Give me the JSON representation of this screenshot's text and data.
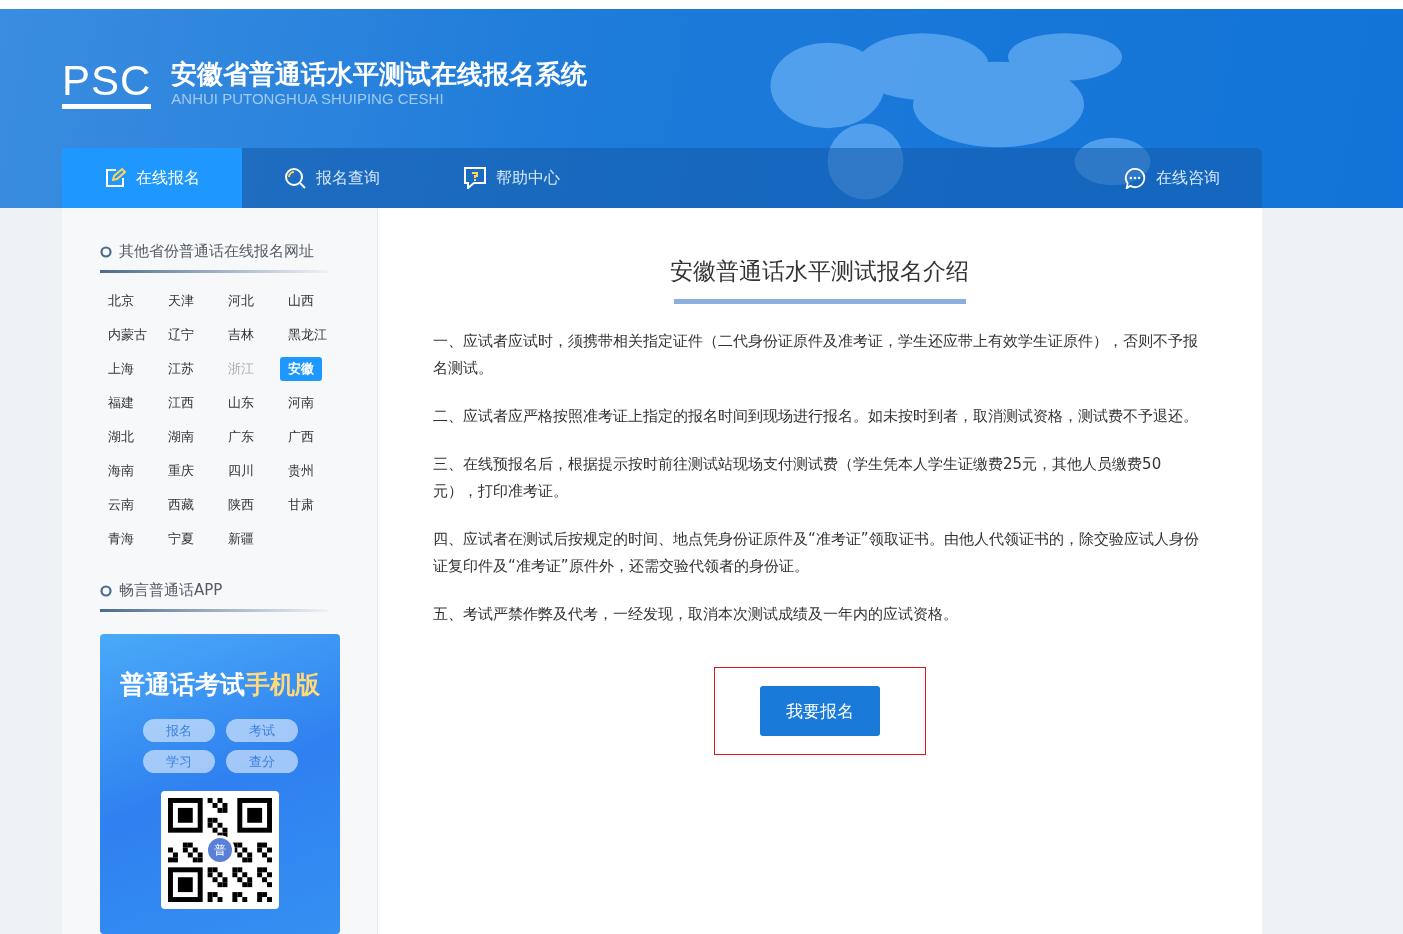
{
  "header": {
    "logo": "PSC",
    "title": "安徽省普通话水平测试在线报名系统",
    "subtitle": "ANHUI PUTONGHUA SHUIPING CESHI"
  },
  "nav": [
    {
      "label": "在线报名",
      "selected": true
    },
    {
      "label": "报名查询",
      "selected": false
    },
    {
      "label": "帮助中心",
      "selected": false
    }
  ],
  "consult": {
    "label": "在线咨询"
  },
  "sidebar": {
    "provinces_title": "其他省份普通话在线报名网址",
    "provinces": [
      {
        "label": "北京",
        "selected": false,
        "disabled": false
      },
      {
        "label": "天津",
        "selected": false,
        "disabled": false
      },
      {
        "label": "河北",
        "selected": false,
        "disabled": false
      },
      {
        "label": "山西",
        "selected": false,
        "disabled": false
      },
      {
        "label": "内蒙古",
        "selected": false,
        "disabled": false
      },
      {
        "label": "辽宁",
        "selected": false,
        "disabled": false
      },
      {
        "label": "吉林",
        "selected": false,
        "disabled": false
      },
      {
        "label": "黑龙江",
        "selected": false,
        "disabled": false
      },
      {
        "label": "上海",
        "selected": false,
        "disabled": false
      },
      {
        "label": "江苏",
        "selected": false,
        "disabled": false
      },
      {
        "label": "浙江",
        "selected": false,
        "disabled": true
      },
      {
        "label": "安徽",
        "selected": true,
        "disabled": false
      },
      {
        "label": "福建",
        "selected": false,
        "disabled": false
      },
      {
        "label": "江西",
        "selected": false,
        "disabled": false
      },
      {
        "label": "山东",
        "selected": false,
        "disabled": false
      },
      {
        "label": "河南",
        "selected": false,
        "disabled": false
      },
      {
        "label": "湖北",
        "selected": false,
        "disabled": false
      },
      {
        "label": "湖南",
        "selected": false,
        "disabled": false
      },
      {
        "label": "广东",
        "selected": false,
        "disabled": false
      },
      {
        "label": "广西",
        "selected": false,
        "disabled": false
      },
      {
        "label": "海南",
        "selected": false,
        "disabled": false
      },
      {
        "label": "重庆",
        "selected": false,
        "disabled": false
      },
      {
        "label": "四川",
        "selected": false,
        "disabled": false
      },
      {
        "label": "贵州",
        "selected": false,
        "disabled": false
      },
      {
        "label": "云南",
        "selected": false,
        "disabled": false
      },
      {
        "label": "西藏",
        "selected": false,
        "disabled": false
      },
      {
        "label": "陕西",
        "selected": false,
        "disabled": false
      },
      {
        "label": "甘肃",
        "selected": false,
        "disabled": false
      },
      {
        "label": "青海",
        "selected": false,
        "disabled": false
      },
      {
        "label": "宁夏",
        "selected": false,
        "disabled": false
      },
      {
        "label": "新疆",
        "selected": false,
        "disabled": false
      }
    ],
    "app_title": "畅言普通话APP",
    "app_card": {
      "title": "普通话考试",
      "title_highlight": "手机版",
      "tags": [
        "报名",
        "考试",
        "学习",
        "查分"
      ],
      "qr_badge": "普"
    }
  },
  "main": {
    "title": "安徽普通话水平测试报名介绍",
    "paragraphs": [
      "一、应试者应试时，须携带相关指定证件（二代身份证原件及准考证，学生还应带上有效学生证原件），否则不予报名测试。",
      "二、应试者应严格按照准考证上指定的报名时间到现场进行报名。如未按时到者，取消测试资格，测试费不予退还。",
      "三、在线预报名后，根据提示按时前往测试站现场支付测试费（学生凭本人学生证缴费25元，其他人员缴费50元），打印准考证。",
      "四、应试者在测试后按规定的时间、地点凭身份证原件及“准考证”领取证书。由他人代领证书的，除交验应试人身份证复印件及“准考证”原件外，还需交验代领者的身份证。",
      "五、考试严禁作弊及代考，一经发现，取消本次测试成绩及一年内的应试资格。"
    ],
    "button": "我要报名",
    "button_highlighted": true
  }
}
